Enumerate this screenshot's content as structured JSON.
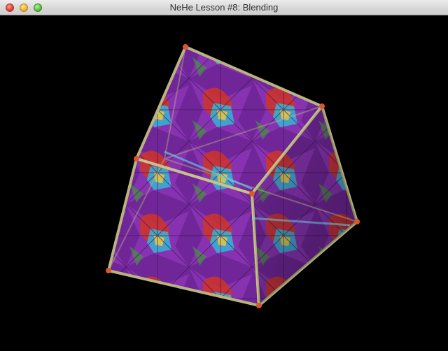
{
  "window": {
    "title": "NeHe Lesson #8: Blending"
  },
  "titlebar_buttons": {
    "close_icon": "close-icon",
    "minimize_icon": "minimize-icon",
    "zoom_icon": "zoom-icon"
  },
  "scene": {
    "object": "blended-textured-cube",
    "background_color": "#000000",
    "texture_colors": [
      "#8a35b5",
      "#e23a2a",
      "#37c3e0",
      "#f5d64a",
      "#4fa84a"
    ]
  }
}
